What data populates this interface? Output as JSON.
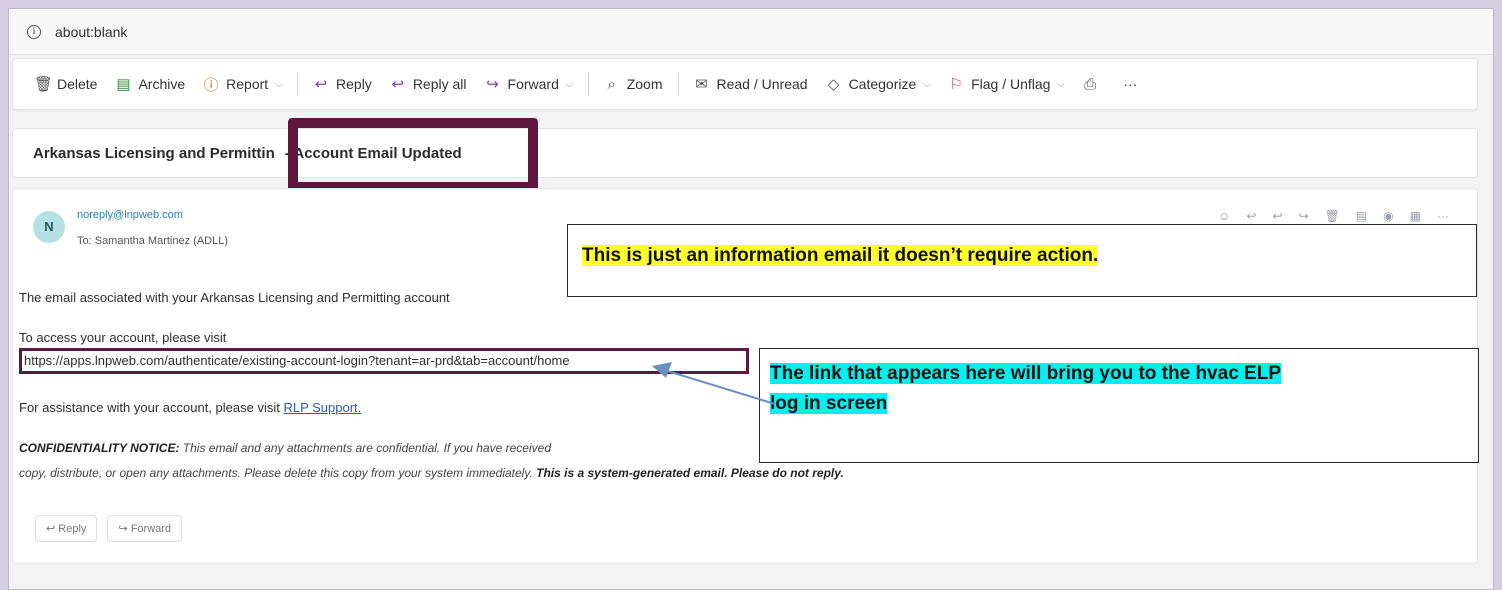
{
  "address_bar": {
    "url": "about:blank"
  },
  "toolbar": {
    "delete": "Delete",
    "archive": "Archive",
    "report": "Report",
    "reply": "Reply",
    "reply_all": "Reply all",
    "forward": "Forward",
    "zoom": "Zoom",
    "read_unread": "Read / Unread",
    "categorize": "Categorize",
    "flag_unflag": "Flag / Unflag",
    "more": "···"
  },
  "email": {
    "subject_part1": "Arkansas Licensing and Permittin",
    "subject_part2": "- Account Email Updated",
    "avatar_letter": "N",
    "sender": "noreply@lnpweb.com",
    "to": "To: Samantha Martinez (ADLL)",
    "body_line1": "The email associated with your Arkansas Licensing and Permitting account",
    "body_line2": "To access your account, please visit",
    "link": "https://apps.lnpweb.com/authenticate/existing-account-login?tenant=ar-prd&tab=account/home",
    "assist_prefix": "For assistance with your account, please visit ",
    "assist_link": "RLP Support.",
    "notice_label": "CONFIDENTIALITY NOTICE:",
    "notice_line1": " This email and any attachments are confidential. If you have received",
    "notice_line2": "copy, distribute, or open any attachments. Please delete this copy from your system immediately. ",
    "notice_bold": "This is a system-generated email. Please do not reply.",
    "reply_btn": "Reply",
    "forward_btn": "Forward"
  },
  "callouts": {
    "info": "This is just an information email it doesn’t require action.",
    "link_line1": "The link that appears here will bring you to the hvac ELP",
    "link_line2": "log in screen"
  },
  "colors": {
    "highlight_box": "#5e1840",
    "yellow_highlight": "#ffff2e",
    "cyan_highlight": "#00f0f0",
    "arrow": "#6a8fc4"
  }
}
